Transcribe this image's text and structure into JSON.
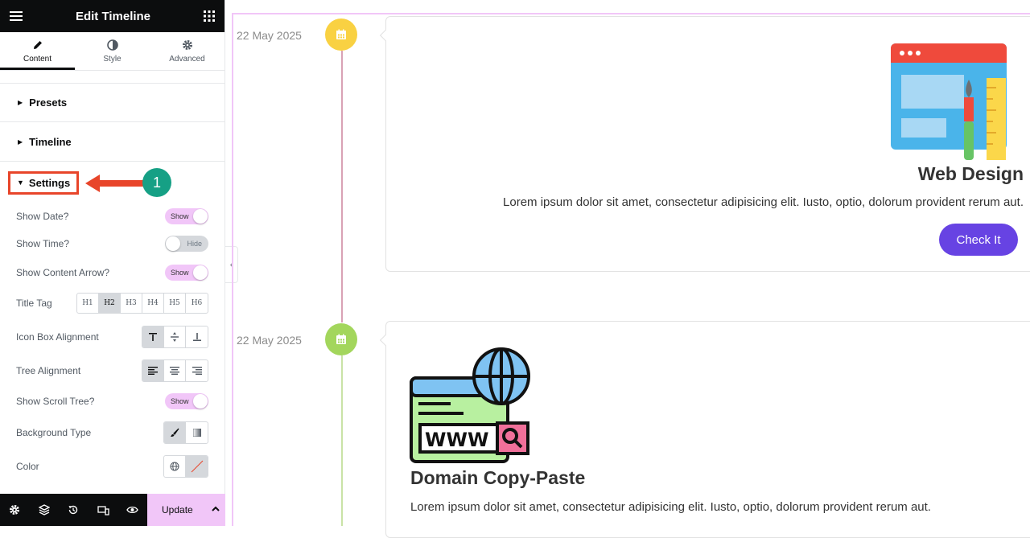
{
  "editor": {
    "title": "Edit Timeline",
    "tabs": [
      {
        "label": "Content",
        "icon": "pencil-icon",
        "active": true
      },
      {
        "label": "Style",
        "icon": "contrast-icon",
        "active": false
      },
      {
        "label": "Advanced",
        "icon": "gear-icon",
        "active": false
      }
    ],
    "sections": {
      "presets": "Presets",
      "timeline": "Timeline",
      "settings": "Settings"
    },
    "callout_number": "1",
    "settings": {
      "show_date": {
        "label": "Show Date?",
        "state": "Show"
      },
      "show_time": {
        "label": "Show Time?",
        "state": "Hide"
      },
      "show_arrow": {
        "label": "Show Content Arrow?",
        "state": "Show"
      },
      "title_tag": {
        "label": "Title Tag",
        "options": [
          "H1",
          "H2",
          "H3",
          "H4",
          "H5",
          "H6"
        ],
        "selected": "H2"
      },
      "icon_box_alignment": {
        "label": "Icon Box Alignment"
      },
      "tree_alignment": {
        "label": "Tree Alignment"
      },
      "show_scroll_tree": {
        "label": "Show Scroll Tree?",
        "state": "Show"
      },
      "background_type": {
        "label": "Background Type"
      },
      "color": {
        "label": "Color"
      }
    },
    "update_label": "Update"
  },
  "timeline": {
    "items": [
      {
        "date": "22 May 2025",
        "icon": "calendar-icon",
        "dot_color": "#f9d142",
        "title": "Web Design",
        "text": "Lorem ipsum dolor sit amet, consectetur adipisicing elit. Iusto, optio, dolorum provident rerum aut.",
        "button": "Check It"
      },
      {
        "date": "22 May 2025",
        "icon": "calendar-icon",
        "dot_color": "#a3d65c",
        "title": "Domain Copy-Paste",
        "text": "Lorem ipsum dolor sit amet, consectetur adipisicing elit. Iusto, optio, dolorum provident rerum aut."
      }
    ]
  },
  "colors": {
    "accent_pink": "#f1c6f8",
    "button_purple": "#6743e3",
    "callout_red": "#e8452a",
    "callout_teal": "#16a085"
  }
}
